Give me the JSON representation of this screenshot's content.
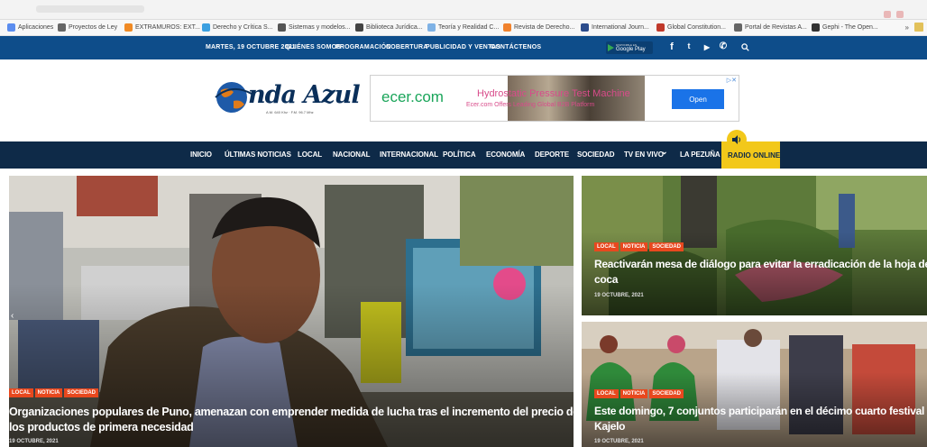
{
  "bookmarks": [
    {
      "label": "Aplicaciones",
      "color": "#5b8def"
    },
    {
      "label": "Proyectos de Ley",
      "color": "#666666"
    },
    {
      "label": "EXTRAMUROS: EXT...",
      "color": "#f08a24"
    },
    {
      "label": "Derecho y Crítica S...",
      "color": "#3ca0e0"
    },
    {
      "label": "Sistemas y modelos...",
      "color": "#555555"
    },
    {
      "label": "Biblioteca Jurídica...",
      "color": "#444444"
    },
    {
      "label": "Teoría y Realidad C...",
      "color": "#7fb2e5"
    },
    {
      "label": "Revista de Derecho...",
      "color": "#f0822d"
    },
    {
      "label": "International Journ...",
      "color": "#2c4c8c"
    },
    {
      "label": "Global Constitution...",
      "color": "#c0392b"
    },
    {
      "label": "Portal de Revistas A...",
      "color": "#666666"
    },
    {
      "label": "Gephi - The Open...",
      "color": "#333333"
    }
  ],
  "bookmarks_more": "»",
  "topbar": {
    "date": "MARTES, 19 OCTUBRE 2021",
    "links": [
      "QUIÉNES SOMOS",
      "PROGRAMACIÓN",
      "COBERTURA",
      "PUBLICIDAD Y VENTAS",
      "CONTÁCTENOS"
    ],
    "gplay_small": "DISPONIBLE EN",
    "gplay_label": "Google Play",
    "social": [
      {
        "icon": "facebook-icon",
        "glyph": "f"
      },
      {
        "icon": "twitter-icon",
        "glyph": "t"
      },
      {
        "icon": "youtube-icon",
        "glyph": "▶"
      },
      {
        "icon": "whatsapp-icon",
        "glyph": "✆"
      }
    ]
  },
  "logo": {
    "text": "nda Azul",
    "tagline": "A.M. 640 Khz · F.M. 96.7 Mhz"
  },
  "ad": {
    "brand": "ecer.com",
    "headline": "Hydrostatic Pressure Test Machine",
    "subline": "Ecer.com Offers Leading Global B2B Platform",
    "button": "Open",
    "adchoices": "▷✕"
  },
  "nav": {
    "items": [
      "INICIO",
      "ÚLTIMAS NOTICIAS",
      "LOCAL",
      "NACIONAL",
      "INTERNACIONAL",
      "POLÍTICA",
      "ECONOMÍA",
      "DEPORTE",
      "SOCIEDAD",
      "TV EN VIVO",
      "LA PEZUÑA"
    ],
    "tv_chevron": "⌄",
    "radio": "RADIO ONLINE"
  },
  "stories": [
    {
      "tags": [
        "LOCAL",
        "NOTICIA",
        "SOCIEDAD"
      ],
      "title": "Organizaciones populares de Puno, amenazan con emprender medida de lucha tras el incremento del precio de los productos de primera necesidad",
      "title_l1": "Organizaciones populares de Puno, amenazan con emprender medida de lucha tras el incremento del precio de",
      "title_l2": "los productos de primera necesidad",
      "date": "19 OCTUBRE, 2021"
    },
    {
      "tags": [
        "LOCAL",
        "NOTICIA",
        "SOCIEDAD"
      ],
      "title_l1": "Reactivarán mesa de diálogo para evitar la erradicación de la hoja de",
      "title_l2": "coca",
      "date": "19 OCTUBRE, 2021"
    },
    {
      "tags": [
        "LOCAL",
        "NOTICIA",
        "SOCIEDAD"
      ],
      "title_l1": "Este domingo, 7 conjuntos participarán en el décimo cuarto festival",
      "title_l2": "Kajelo",
      "date": "19 OCTUBRE, 2021"
    }
  ],
  "colors": {
    "topbar": "#0e4d8a",
    "nav": "#0e2a48",
    "radio": "#f2c81a",
    "tag": "#e8481e"
  }
}
